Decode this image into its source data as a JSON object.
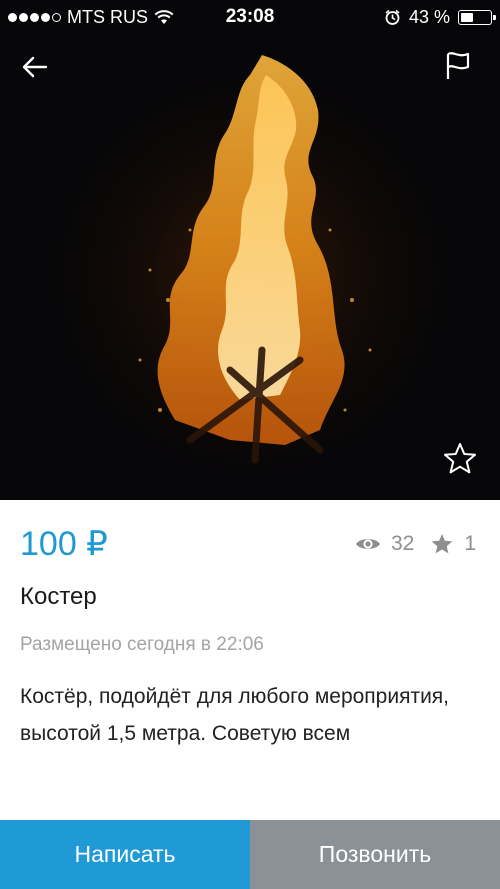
{
  "status_bar": {
    "carrier": "MTS RUS",
    "time": "23:08",
    "battery_text": "43 %",
    "battery_level": 0.43
  },
  "nav": {
    "back_icon": "arrow-left-icon",
    "report_icon": "flag-icon",
    "favorite_icon": "star-outline-icon"
  },
  "listing": {
    "price": "100 ₽",
    "views": "32",
    "favorites": "1",
    "title": "Костер",
    "posted": "Размещено сегодня в 22:06",
    "description": "Костёр, подойдёт для любого мероприятия, высотой 1,5 метра. Советую всем"
  },
  "actions": {
    "write_label": "Написать",
    "call_label": "Позвонить"
  },
  "colors": {
    "accent": "#1f98d3",
    "write_button": "#209ad7",
    "call_button": "#8b9297",
    "muted_text": "#8e8e8e"
  }
}
